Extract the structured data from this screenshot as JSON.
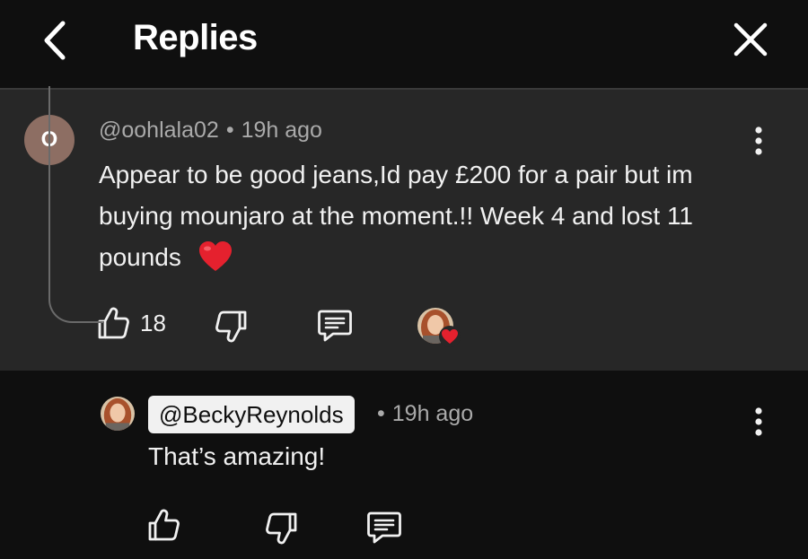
{
  "header": {
    "title": "Replies",
    "back_icon": "chevron-left-icon",
    "close_icon": "close-icon"
  },
  "comment": {
    "avatar_letter": "O",
    "avatar_color": "#8d6e63",
    "username": "@oohlala02",
    "separator": "•",
    "time": "19h ago",
    "text": "Appear to be good jeans,Id pay £200 for a pair but im buying mounjaro at the moment.!! Week 4 and lost 11 pounds",
    "emoji": "heart-emoji",
    "like_count": "18",
    "creator_heart": true
  },
  "reply": {
    "mention": "@BeckyReynolds",
    "separator": "•",
    "time": "19h ago",
    "text": "That’s amazing!"
  },
  "colors": {
    "background": "#0f0f0f",
    "comment_highlight": "#272727",
    "text_primary": "#f1f1f1",
    "text_secondary": "#aaaaaa",
    "heart_red": "#e5212e"
  }
}
